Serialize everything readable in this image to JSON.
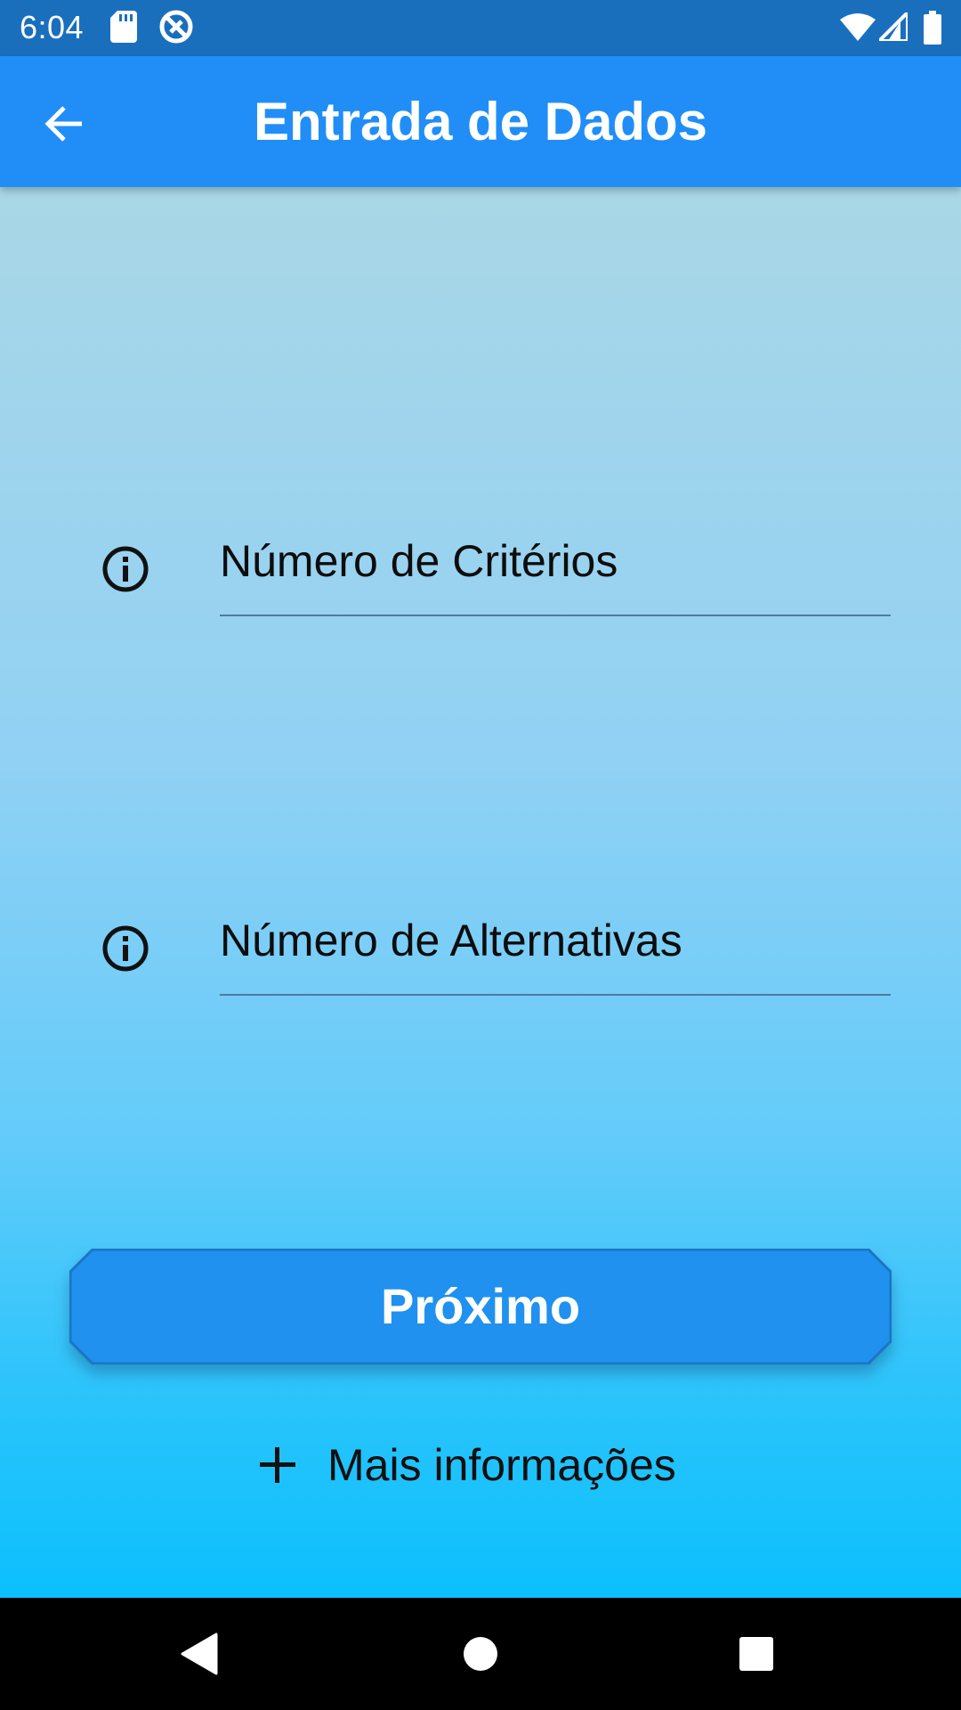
{
  "status_bar": {
    "time": "6:04",
    "icons": [
      "sd-card-icon",
      "sync-icon",
      "wifi-icon",
      "signal-icon",
      "battery-icon"
    ]
  },
  "app_bar": {
    "title": "Entrada de Dados",
    "back_icon": "arrow-back-icon",
    "color": "#218ef8"
  },
  "form": {
    "criteria_field": {
      "placeholder": "Número de Critérios",
      "value": "",
      "icon": "info-icon"
    },
    "alternatives_field": {
      "placeholder": "Número de Alternativas",
      "value": "",
      "icon": "info-icon"
    }
  },
  "actions": {
    "next_label": "Próximo",
    "next_color": "#2091ee",
    "more_info_label": "Mais informações",
    "more_info_icon": "plus-icon"
  },
  "nav_bar": {
    "buttons": [
      "back-triangle-icon",
      "home-circle-icon",
      "recents-square-icon"
    ]
  }
}
